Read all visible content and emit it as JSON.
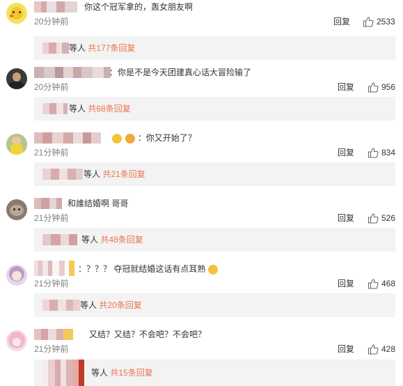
{
  "comments": [
    {
      "username": "兄人猫迷猫",
      "text": "你这个冠军拿的，轰女朋友啊",
      "time": "20分钟前",
      "reply_label": "回复",
      "likes": "2533",
      "reply_user": "哈哈哈",
      "reply_deng": "等人",
      "reply_more": "共177条回复",
      "avatar_icon": "pikachu-avatar"
    },
    {
      "username": "迷你彩色小猫咪",
      "text": "：你是不是今天团建真心话大冒险输了",
      "time": "20分钟前",
      "reply_label": "回复",
      "likes": "956",
      "reply_user": "阿一",
      "reply_deng": "等人",
      "reply_more": "共68条回复",
      "avatar_icon": "person-avatar"
    },
    {
      "username": "小小彩虹糖一只",
      "text": "：你又开始了？",
      "time": "21分钟前",
      "reply_label": "回复",
      "likes": "834",
      "reply_user": "彩色的糖",
      "reply_deng": "等人",
      "reply_more": "共21条回复",
      "avatar_icon": "child-avatar"
    },
    {
      "username": "蘑菇",
      "text": "和誰结婚啊 哥哥",
      "time": "21分钟前",
      "reply_label": "回复",
      "likes": "526",
      "reply_user": "小心仙子",
      "reply_deng": "等人",
      "reply_more": "共48条回复",
      "avatar_icon": "cat-avatar"
    },
    {
      "username": "粉色",
      "text": "：？？？ 夺冠就结婚这话有点耳熟",
      "time": "21分钟前",
      "reply_label": "回复",
      "likes": "468",
      "reply_user": "Honey",
      "reply_deng": "等人",
      "reply_more": "共20条回复",
      "avatar_icon": "anime-girl-avatar"
    },
    {
      "username": "小猫",
      "text": "又结？又结？不会吧？不会吧？",
      "time": "21分钟前",
      "reply_label": "回复",
      "likes": "428",
      "reply_user": "色块",
      "reply_deng": "等人",
      "reply_more": "共15条回复",
      "avatar_icon": "pink-anime-avatar"
    }
  ],
  "colors": {
    "link": "#eb7350",
    "muted": "#808080",
    "reply_bar_bg": "#f3f3f3"
  }
}
